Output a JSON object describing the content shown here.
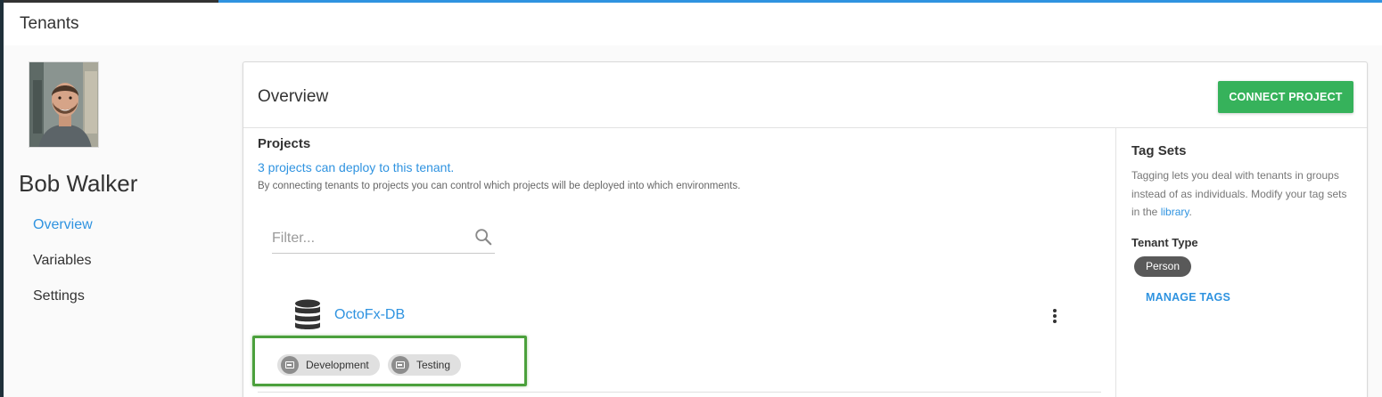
{
  "page": {
    "title": "Tenants"
  },
  "tenant": {
    "name": "Bob Walker",
    "nav": [
      {
        "label": "Overview",
        "active": true
      },
      {
        "label": "Variables",
        "active": false
      },
      {
        "label": "Settings",
        "active": false
      }
    ]
  },
  "overview": {
    "title": "Overview",
    "connect_label": "CONNECT PROJECT",
    "projects": {
      "heading": "Projects",
      "count_text": "3 projects can deploy to this tenant.",
      "description": "By connecting tenants to projects you can control which projects will be deployed into which environments.",
      "filter_placeholder": "Filter...",
      "items": [
        {
          "name": "OctoFx-DB",
          "icon": "database-icon",
          "environments": [
            "Development",
            "Testing"
          ]
        }
      ]
    },
    "tag_sets": {
      "heading": "Tag Sets",
      "description_before": "Tagging lets you deal with tenants in groups instead of as individuals. Modify your tag sets in the ",
      "library_link": "library",
      "description_after": ".",
      "tenant_type_heading": "Tenant Type",
      "tenant_type_value": "Person",
      "manage_label": "MANAGE TAGS"
    }
  },
  "colors": {
    "accent_blue": "#2f93e0",
    "success_green": "#36b25b",
    "highlight_green": "#4ba03c"
  }
}
